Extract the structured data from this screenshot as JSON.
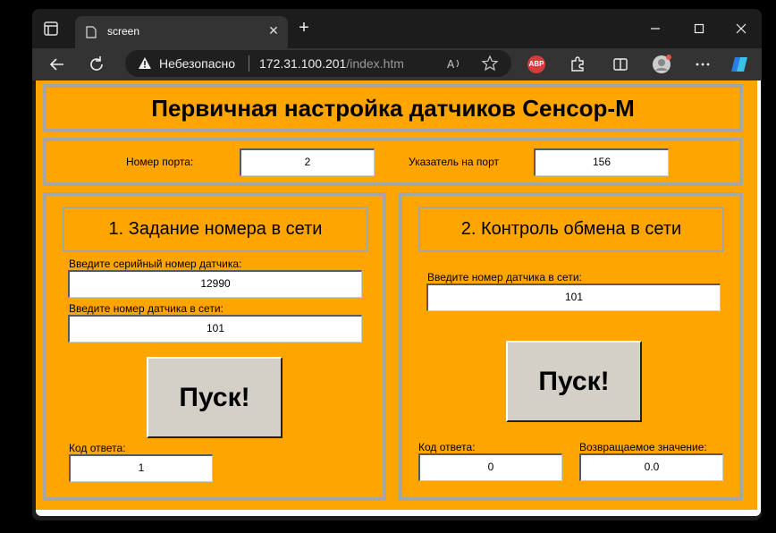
{
  "browser": {
    "tab_title": "screen",
    "security_label": "Небезопасно",
    "url_host": "172.31.100.201",
    "url_path": "/index.htm",
    "abp_label": "ABP"
  },
  "page": {
    "title": "Первичная настройка датчиков Сенсор-М",
    "port": {
      "port_number_label": "Номер порта:",
      "port_number_value": "2",
      "pointer_label": "Указатель на порт",
      "pointer_value": "156"
    },
    "section1": {
      "title": "1. Задание номера в сети",
      "serial_label": "Введите серийный номер датчика:",
      "serial_value": "12990",
      "net_label": "Введите номер датчика в сети:",
      "net_value": "101",
      "button": "Пуск!",
      "response_label": "Код ответа:",
      "response_value": "1"
    },
    "section2": {
      "title": "2. Контроль обмена в сети",
      "net_label": "Введите номер датчика в сети:",
      "net_value": "101",
      "button": "Пуск!",
      "response_label": "Код ответа:",
      "response_value": "0",
      "return_label": "Возвращаемое значение:",
      "return_value": "0.0"
    }
  },
  "colors": {
    "page_bg": "#ffa500",
    "frame_border": "#a6a6a6",
    "button_face": "#d4d0c8",
    "browser_chrome": "#333333"
  }
}
